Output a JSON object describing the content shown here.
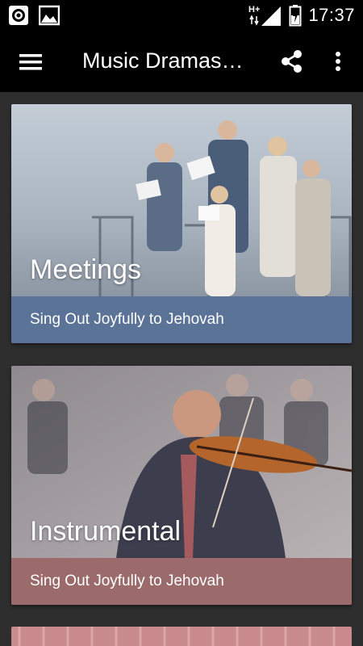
{
  "status_bar": {
    "time": "17:37",
    "network": "H+",
    "icons": [
      "record-icon",
      "image-icon",
      "signal-icon",
      "battery-charging-icon"
    ]
  },
  "toolbar": {
    "title": "Music Dramas…",
    "icons": [
      "menu-icon",
      "share-icon",
      "more-vert-icon"
    ]
  },
  "cards": [
    {
      "title": "Meetings",
      "subtitle": "Sing Out Joyfully to Jehovah",
      "footer_color": "#5a7397"
    },
    {
      "title": "Instrumental",
      "subtitle": "Sing Out Joyfully to Jehovah",
      "footer_color": "#9b6b6c"
    }
  ],
  "colors": {
    "bar_background": "#000000",
    "page_background": "#2e2e2e",
    "third_card_peek": "#c98a8e"
  }
}
